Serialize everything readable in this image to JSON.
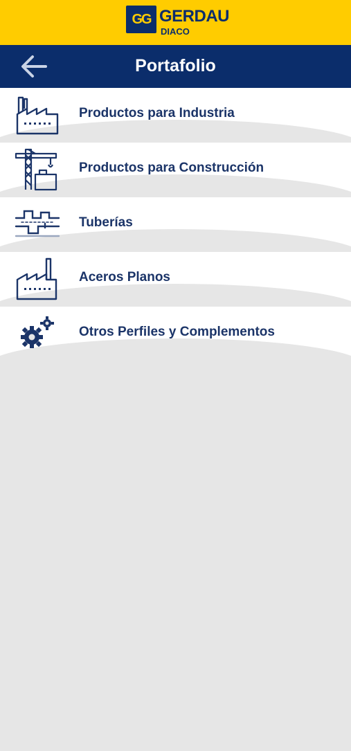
{
  "brand": {
    "mark": "GG",
    "name": "GERDAU",
    "sub": "DIACO",
    "colors": {
      "yellow": "#ffcc00",
      "navy": "#0b2d6b"
    }
  },
  "header": {
    "title": "Portafolio",
    "back_icon": "back-arrow-icon"
  },
  "items": [
    {
      "label": "Productos para Industria",
      "icon": "factory-icon"
    },
    {
      "label": "Productos para Construcción",
      "icon": "crane-icon"
    },
    {
      "label": "Tuberías",
      "icon": "pipes-icon"
    },
    {
      "label": "Aceros Planos",
      "icon": "factory-icon"
    },
    {
      "label": "Otros Perfiles y Complementos",
      "icon": "gears-icon"
    }
  ]
}
